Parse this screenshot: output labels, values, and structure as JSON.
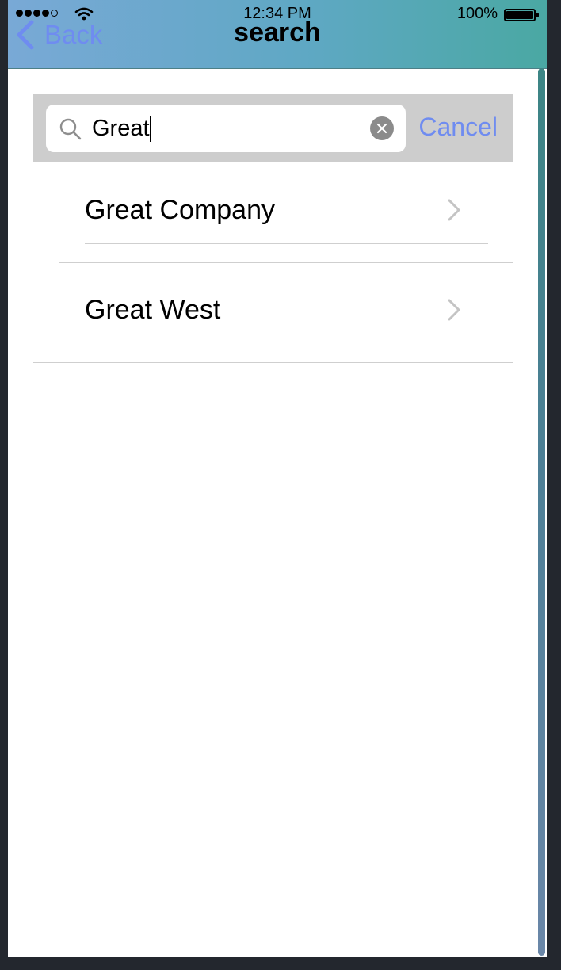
{
  "status_bar": {
    "time": "12:34 PM",
    "battery": "100%"
  },
  "nav": {
    "back_label": "Back",
    "title": "search"
  },
  "search": {
    "value": "Great",
    "cancel_label": "Cancel"
  },
  "results": [
    {
      "label": "Great Company"
    },
    {
      "label": "Great West"
    }
  ],
  "colors": {
    "accent": "#6f8cf0",
    "nav_gradient_start": "#79a9d6",
    "nav_gradient_end": "#4aa8a3",
    "search_bar_bg": "#cdcdcd"
  }
}
